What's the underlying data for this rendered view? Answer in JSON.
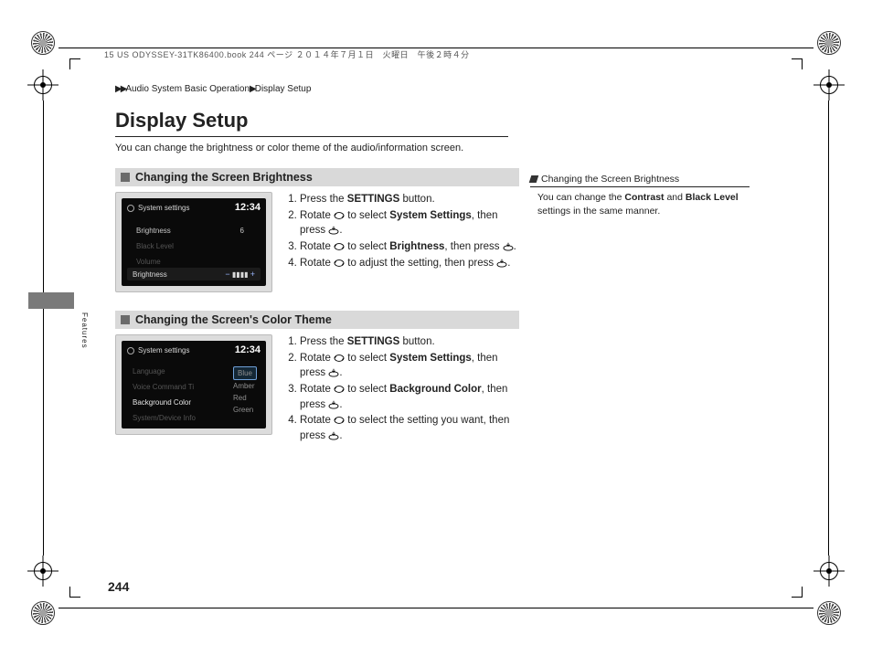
{
  "print_header": "15 US ODYSSEY-31TK86400.book  244 ページ  ２０１４年７月１日　火曜日　午後２時４分",
  "breadcrumb": {
    "arrows": "▶▶",
    "seg1": "Audio System Basic Operation",
    "sep": "▶",
    "seg2": "Display Setup"
  },
  "title": "Display Setup",
  "lead": "You can change the brightness or color theme of the audio/information screen.",
  "section1": {
    "heading": "Changing the Screen Brightness",
    "screen": {
      "title": "System settings",
      "clock": "12:34",
      "row_label": "Brightness",
      "row_value": "6",
      "dim1": "Black Level",
      "dim2": "Volume",
      "bar_label": "Brightness",
      "bar_minus": "−",
      "bar_plus": "+",
      "bar_fill": "▮▮▮▮"
    },
    "steps": {
      "s1a": "Press the ",
      "s1b": "SETTINGS",
      "s1c": " button.",
      "s2a": "Rotate ",
      "s2b": " to select ",
      "s2c": "System Settings",
      "s2d": ", then press ",
      "s2e": ".",
      "s3a": "Rotate ",
      "s3b": " to select ",
      "s3c": "Brightness",
      "s3d": ", then press ",
      "s3e": ".",
      "s4a": "Rotate ",
      "s4b": " to adjust the setting, then press ",
      "s4c": "."
    }
  },
  "section2": {
    "heading": "Changing the Screen's Color Theme",
    "screen": {
      "title": "System settings",
      "clock": "12:34",
      "dim1": "Language",
      "dim2": "Voice Command Ti",
      "row_label": "Background Color",
      "dim3": "System/Device Info",
      "opt_sel": "Blue",
      "opt2": "Amber",
      "opt3": "Red",
      "opt4": "Green"
    },
    "steps": {
      "s1a": "Press the ",
      "s1b": "SETTINGS",
      "s1c": " button.",
      "s2a": "Rotate ",
      "s2b": " to select ",
      "s2c": "System Settings",
      "s2d": ", then press ",
      "s2e": ".",
      "s3a": "Rotate ",
      "s3b": " to select ",
      "s3c": "Background Color",
      "s3d": ", then press ",
      "s3e": ".",
      "s4a": "Rotate ",
      "s4b": " to select the setting you want, then press ",
      "s4c": "."
    }
  },
  "sidebar": {
    "head": "Changing the Screen Brightness",
    "p1": "You can change the ",
    "b1": "Contrast",
    "p2": " and ",
    "b2": "Black Level",
    "p3": " settings in the same manner."
  },
  "side_label": "Features",
  "page_number": "244"
}
